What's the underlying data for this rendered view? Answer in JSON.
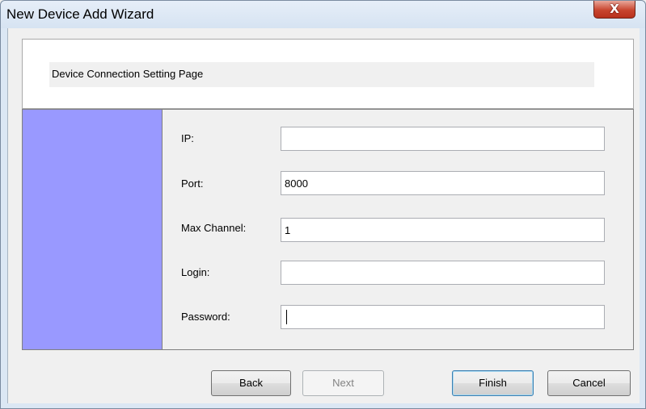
{
  "window": {
    "title": "New Device Add Wizard",
    "close_glyph": "X"
  },
  "header": {
    "label": "Device Connection Setting Page"
  },
  "form": {
    "ip": {
      "label": "IP:",
      "value": ""
    },
    "port": {
      "label": "Port:",
      "value": "8000"
    },
    "max_channel": {
      "label": "Max Channel:",
      "value": "1"
    },
    "login": {
      "label": "Login:",
      "value": ""
    },
    "password": {
      "label": "Password:",
      "value": ""
    }
  },
  "buttons": {
    "back": "Back",
    "next": "Next",
    "finish": "Finish",
    "cancel": "Cancel"
  },
  "colors": {
    "side_bar": "#9999ff",
    "close_button": "#c8452f"
  },
  "icons": {
    "close": "close-icon"
  }
}
